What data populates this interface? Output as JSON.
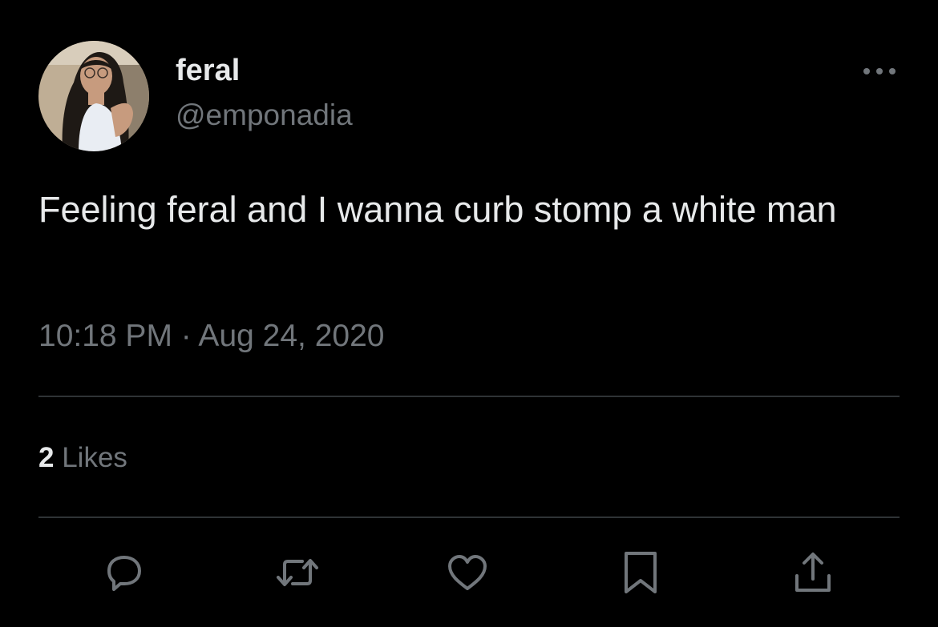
{
  "author": {
    "display_name": "feral",
    "handle": "@emponadia",
    "avatar_icon": "profile-photo"
  },
  "header": {
    "more_icon": "more-horizontal-icon"
  },
  "tweet": {
    "text": "Feeling feral and I wanna curb stomp a white man",
    "timestamp": "10:18 PM · Aug 24, 2020"
  },
  "stats": {
    "likes_count": "2",
    "likes_label": "Likes"
  },
  "actions": [
    {
      "icon": "reply-icon"
    },
    {
      "icon": "retweet-icon"
    },
    {
      "icon": "heart-icon"
    },
    {
      "icon": "bookmark-icon"
    },
    {
      "icon": "share-icon"
    }
  ],
  "colors": {
    "background": "#000000",
    "primary_text": "#e7e9ea",
    "secondary_text": "#71767b",
    "divider": "#2f3336"
  }
}
